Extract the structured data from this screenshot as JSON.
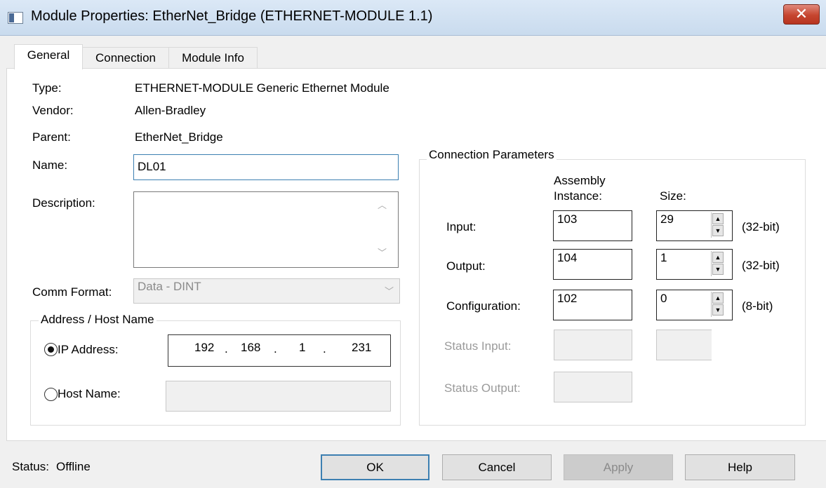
{
  "window": {
    "title": "Module Properties: EtherNet_Bridge (ETHERNET-MODULE 1.1)",
    "close_glyph": "✕"
  },
  "tabs": [
    {
      "label": "General",
      "active": true
    },
    {
      "label": "Connection",
      "active": false
    },
    {
      "label": "Module Info",
      "active": false
    }
  ],
  "general": {
    "type_label": "Type:",
    "type_value": "ETHERNET-MODULE Generic Ethernet Module",
    "vendor_label": "Vendor:",
    "vendor_value": "Allen-Bradley",
    "parent_label": "Parent:",
    "parent_value": "EtherNet_Bridge",
    "name_label": "Name:",
    "name_value": "DL01",
    "description_label": "Description:",
    "description_value": "",
    "comm_format_label": "Comm Format:",
    "comm_format_value": "Data - DINT"
  },
  "address": {
    "group_label": "Address / Host Name",
    "ip_label": "IP Address:",
    "ip_selected": true,
    "ip_octets": [
      "192",
      "168",
      "1",
      "231"
    ],
    "ip_separator": ".",
    "host_label": "Host Name:",
    "host_value": ""
  },
  "connection_parameters": {
    "group_label": "Connection Parameters",
    "col_assembly_line1": "Assembly",
    "col_assembly_line2": "Instance:",
    "col_size": "Size:",
    "rows": [
      {
        "label": "Input:",
        "instance": "103",
        "size": "29",
        "unit": "(32-bit)",
        "enabled": true
      },
      {
        "label": "Output:",
        "instance": "104",
        "size": "1",
        "unit": "(32-bit)",
        "enabled": true
      },
      {
        "label": "Configuration:",
        "instance": "102",
        "size": "0",
        "unit": "(8-bit)",
        "enabled": true
      },
      {
        "label": "Status Input:",
        "instance": "",
        "size": "",
        "unit": "",
        "enabled": false
      },
      {
        "label": "Status Output:",
        "instance": "",
        "size": "",
        "unit": "",
        "enabled": false
      }
    ]
  },
  "footer": {
    "status_label": "Status:",
    "status_value": "Offline",
    "ok": "OK",
    "cancel": "Cancel",
    "apply": "Apply",
    "help": "Help"
  }
}
